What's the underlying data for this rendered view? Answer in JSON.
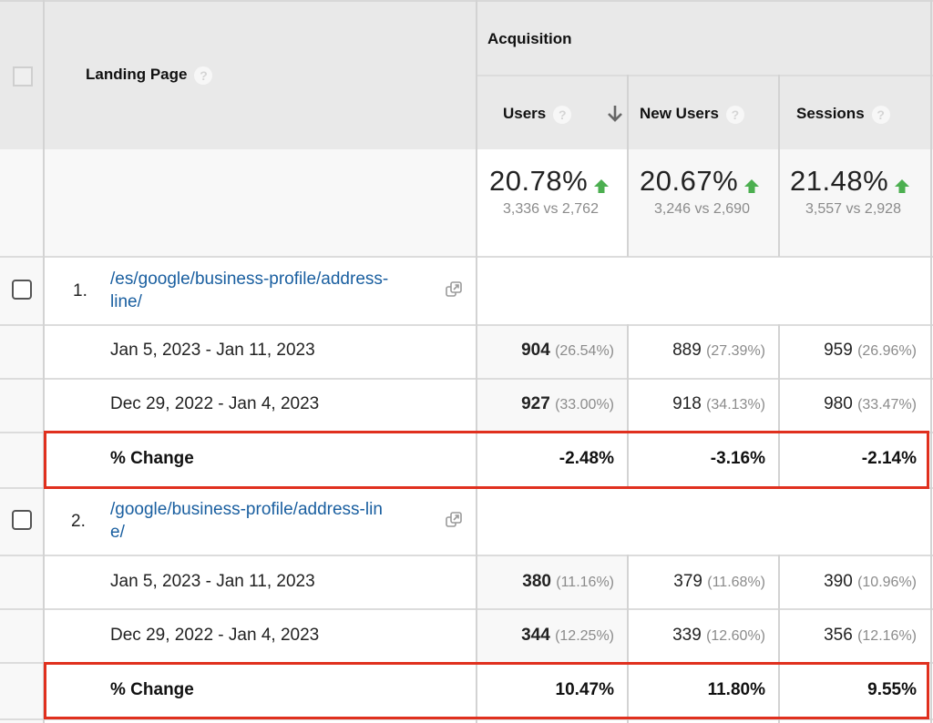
{
  "header": {
    "landing_page_label": "Landing Page",
    "group_label": "Acquisition",
    "columns": [
      {
        "label": "Users",
        "sorted": "descending"
      },
      {
        "label": "New Users"
      },
      {
        "label": "Sessions"
      }
    ],
    "help_glyph": "?",
    "sort_icon": "arrow-down-icon"
  },
  "totals": [
    {
      "change": "20.78%",
      "compare": "3,336 vs 2,762",
      "trend": "up"
    },
    {
      "change": "20.67%",
      "compare": "3,246 vs 2,690",
      "trend": "up"
    },
    {
      "change": "21.48%",
      "compare": "3,557 vs 2,928",
      "trend": "up"
    }
  ],
  "rows": [
    {
      "rank": "1.",
      "page_line1": "/es/google/business-profile/address-",
      "page_line2": "line/",
      "periods": [
        {
          "label": "Jan 5, 2023 - Jan 11, 2023",
          "users": "904",
          "users_pct": "(26.54%)",
          "new_users": "889",
          "new_users_pct": "(27.39%)",
          "sessions": "959",
          "sessions_pct": "(26.96%)"
        },
        {
          "label": "Dec 29, 2022 - Jan 4, 2023",
          "users": "927",
          "users_pct": "(33.00%)",
          "new_users": "918",
          "new_users_pct": "(34.13%)",
          "sessions": "980",
          "sessions_pct": "(33.47%)"
        }
      ],
      "change": {
        "label": "% Change",
        "users": "-2.48%",
        "new_users": "-3.16%",
        "sessions": "-2.14%"
      }
    },
    {
      "rank": "2.",
      "page_line1": "/google/business-profile/address-lin",
      "page_line2": "e/",
      "periods": [
        {
          "label": "Jan 5, 2023 - Jan 11, 2023",
          "users": "380",
          "users_pct": "(11.16%)",
          "new_users": "379",
          "new_users_pct": "(11.68%)",
          "sessions": "390",
          "sessions_pct": "(10.96%)"
        },
        {
          "label": "Dec 29, 2022 - Jan 4, 2023",
          "users": "344",
          "users_pct": "(12.25%)",
          "new_users": "339",
          "new_users_pct": "(12.60%)",
          "sessions": "356",
          "sessions_pct": "(12.16%)"
        }
      ],
      "change": {
        "label": "% Change",
        "users": "10.47%",
        "new_users": "11.80%",
        "sessions": "9.55%"
      }
    }
  ],
  "colors": {
    "link": "#1a5fa0",
    "trend_up": "#4caf50",
    "highlight": "#e0301e",
    "header_bg": "#e9e9e9"
  }
}
